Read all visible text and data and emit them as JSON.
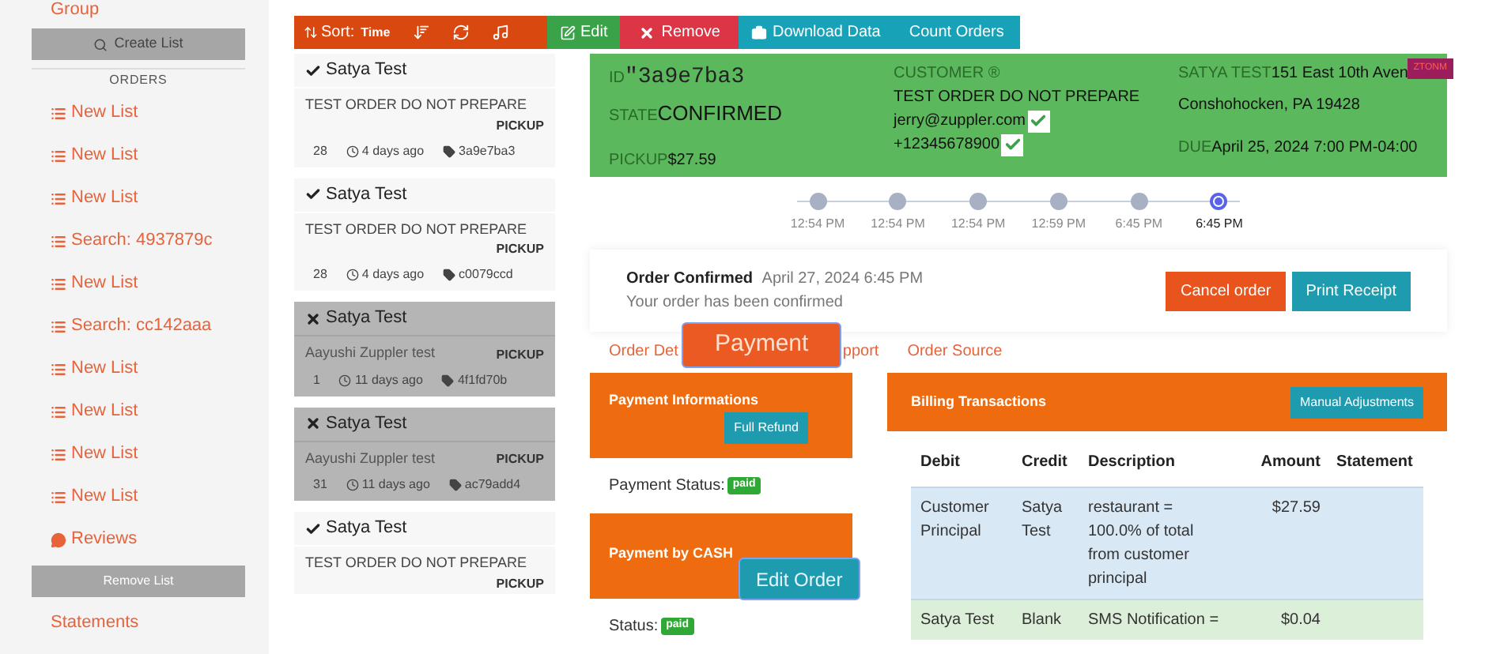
{
  "sidebar": {
    "group_label": "Group",
    "create_button": "Create List",
    "section_title": "ORDERS",
    "items": [
      {
        "kind": "list",
        "label": "New List"
      },
      {
        "kind": "list",
        "label": "New List"
      },
      {
        "kind": "list",
        "label": "New List"
      },
      {
        "kind": "list",
        "label": "Search: 4937879c"
      },
      {
        "kind": "list",
        "label": "New List"
      },
      {
        "kind": "list",
        "label": "Search: cc142aaa"
      },
      {
        "kind": "list",
        "label": "New List"
      },
      {
        "kind": "list",
        "label": "New List"
      },
      {
        "kind": "list",
        "label": "New List"
      },
      {
        "kind": "list",
        "label": "New List"
      },
      {
        "kind": "reviews",
        "label": "Reviews"
      }
    ],
    "remove_button": "Remove List",
    "footer_link": "Statements"
  },
  "toolbar": {
    "sort_label": "Sort:",
    "sort_value": "Time",
    "edit": "Edit",
    "remove": "Remove",
    "download": "Download Data",
    "count": "Count Orders"
  },
  "orders": [
    {
      "name": "Satya Test",
      "cancelled": false,
      "description": "TEST ORDER DO NOT PREPARE",
      "type": "PICKUP",
      "count": "28",
      "age": "4 days ago",
      "id": "3a9e7ba3"
    },
    {
      "name": "Satya Test",
      "cancelled": false,
      "description": "TEST ORDER DO NOT PREPARE",
      "type": "PICKUP",
      "count": "28",
      "age": "4 days ago",
      "id": "c0079ccd"
    },
    {
      "name": "Satya Test",
      "cancelled": true,
      "description": "Aayushi Zuppler test",
      "type": "PICKUP",
      "count": "1",
      "age": "11 days ago",
      "id": "4f1fd70b"
    },
    {
      "name": "Satya Test",
      "cancelled": true,
      "description": "Aayushi Zuppler test",
      "type": "PICKUP",
      "count": "31",
      "age": "11 days ago",
      "id": "ac79add4"
    },
    {
      "name": "Satya Test",
      "cancelled": false,
      "description": "TEST ORDER DO NOT PREPARE",
      "type": "PICKUP"
    }
  ],
  "order_summary": {
    "id_label": "ID",
    "id_value": "\"3a9e7ba3",
    "state_label": "STATE",
    "state_value": "CONFIRMED",
    "pickup_label": "PICKUP",
    "pickup_value": "$27.59",
    "customer_label": "CUSTOMER ®",
    "customer_name": "TEST ORDER DO NOT PREPARE",
    "email": "jerry@zuppler.com",
    "email_verified": true,
    "phone": "+12345678900",
    "phone_verified": true,
    "restaurant_label": "SATYA TEST",
    "address_line1": "151 East 10th Aven",
    "badge": "ZTONM",
    "address_line2": "Conshohocken, PA 19428",
    "due_label": "DUE",
    "due_value": "April 25, 2024 7:00 PM-04:00"
  },
  "timeline": [
    {
      "time": "12:54 PM",
      "selected": false
    },
    {
      "time": "12:54 PM",
      "selected": false
    },
    {
      "time": "12:54 PM",
      "selected": false
    },
    {
      "time": "12:59 PM",
      "selected": false
    },
    {
      "time": "6:45 PM",
      "selected": false
    },
    {
      "time": "6:45 PM",
      "selected": true
    }
  ],
  "status_card": {
    "title": "Order Confirmed",
    "date": "April 27, 2024 6:45 PM",
    "message": "Your order has been confirmed",
    "cancel_button": "Cancel order",
    "print_button": "Print Receipt"
  },
  "tabs": [
    {
      "label": "Order Det"
    },
    {
      "label": "pport"
    },
    {
      "label": "Order Source"
    }
  ],
  "payment_callout": "Payment",
  "payment_info": {
    "title": "Payment Informations",
    "refund_button": "Full Refund",
    "status_label": "Payment Status:",
    "status_badge": "paid"
  },
  "payment_cash": {
    "title": "Payment by CASH",
    "status_label": "Status:",
    "status_badge": "paid"
  },
  "edit_order_callout": "Edit Order",
  "billing": {
    "title": "Billing Transactions",
    "adjust_button": "Manual Adjustments",
    "columns": [
      "Debit",
      "Credit",
      "Description",
      "Amount",
      "Statement"
    ],
    "rows": [
      {
        "debit": "Customer Principal",
        "credit": "Satya Test",
        "description": "restaurant = 100.0% of total from customer principal",
        "amount": "$27.59",
        "color": "#d9e8f5"
      },
      {
        "debit": "Satya Test",
        "credit": "Blank",
        "description": "SMS Notification =",
        "amount": "$0.04",
        "color": "#dcefd8"
      }
    ]
  }
}
